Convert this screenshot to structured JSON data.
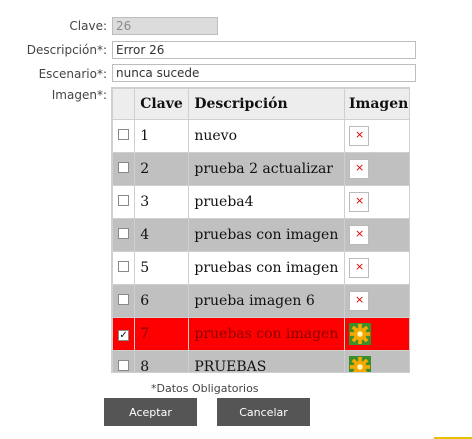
{
  "form": {
    "clave_label": "Clave:",
    "clave_value": "26",
    "descripcion_label": "Descripción*:",
    "descripcion_value": "Error 26",
    "escenario_label": "Escenario*:",
    "escenario_value": "nunca sucede",
    "imagen_label": "Imagen*:"
  },
  "table": {
    "headers": {
      "clave": "Clave",
      "descripcion": "Descripción",
      "imagen": "Imagen"
    },
    "rows": [
      {
        "checked": false,
        "clave": "1",
        "descripcion": "nuevo",
        "image_icon": "broken-image-icon",
        "selected": false
      },
      {
        "checked": false,
        "clave": "2",
        "descripcion": "prueba 2 actualizar",
        "image_icon": "broken-image-icon",
        "selected": false
      },
      {
        "checked": false,
        "clave": "3",
        "descripcion": "prueba4",
        "image_icon": "broken-image-icon",
        "selected": false
      },
      {
        "checked": false,
        "clave": "4",
        "descripcion": "pruebas con imagen",
        "image_icon": "broken-image-icon",
        "selected": false
      },
      {
        "checked": false,
        "clave": "5",
        "descripcion": "pruebas con imagen",
        "image_icon": "broken-image-icon",
        "selected": false
      },
      {
        "checked": false,
        "clave": "6",
        "descripcion": "prueba imagen 6",
        "image_icon": "broken-image-icon",
        "selected": false
      },
      {
        "checked": true,
        "clave": "7",
        "descripcion": "pruebas con imagen",
        "image_icon": "gear-icon",
        "selected": true
      },
      {
        "checked": false,
        "clave": "8",
        "descripcion": "PRUEBAS",
        "image_icon": "gear-icon",
        "selected": false
      }
    ]
  },
  "footer": {
    "note": "*Datos Obligatorios",
    "accept_label": "Aceptar",
    "cancel_label": "Cancelar"
  },
  "colors": {
    "selected_row": "#ff0000",
    "alt_row": "#c0c0c0",
    "button": "#555555",
    "accent": "#e8c200"
  }
}
